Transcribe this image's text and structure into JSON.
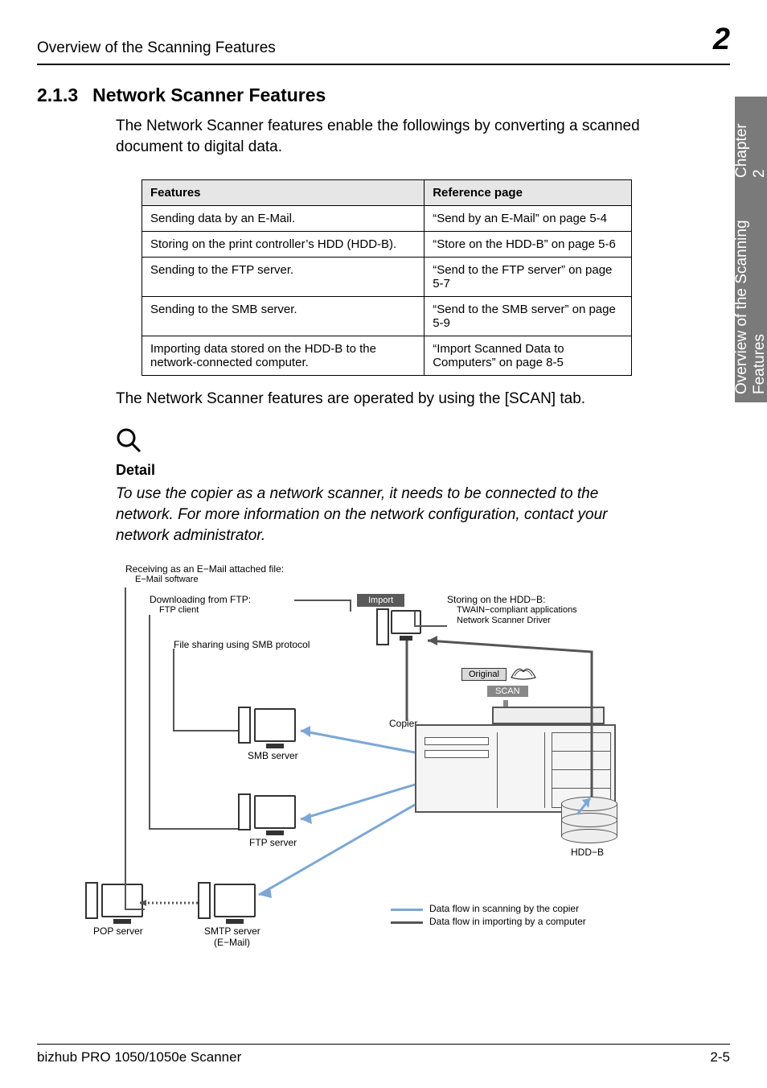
{
  "header": {
    "left": "Overview of the Scanning Features",
    "right": "2"
  },
  "side_tab": {
    "line1": "Overview of the Scanning Features",
    "line2": "Chapter 2"
  },
  "section": {
    "number": "2.1.3",
    "title": "Network Scanner Features",
    "intro": "The Network Scanner features enable the followings by converting a scanned document to digital data."
  },
  "table": {
    "headers": [
      "Features",
      "Reference page"
    ],
    "rows": [
      [
        "Sending data by an E-Mail.",
        "“Send by an E-Mail” on page 5-4"
      ],
      [
        "Storing on the print controller’s HDD (HDD-B).",
        "“Store on the HDD-B” on page 5-6"
      ],
      [
        "Sending to the FTP server.",
        "“Send to the FTP server” on page 5-7"
      ],
      [
        "Sending to the SMB server.",
        "“Send to the SMB server” on page 5-9"
      ],
      [
        "Importing data stored on the HDD-B to the network-connected computer.",
        "“Import Scanned Data to Computers” on page 8-5"
      ]
    ]
  },
  "after_table": "The Network Scanner features are operated by using the [SCAN] tab.",
  "detail": {
    "heading": "Detail",
    "body": "To use the copier as a network scanner, it needs to be connected to the network. For more information on the network configuration, contact your network administrator."
  },
  "diagram": {
    "caption_top1": "Receiving as an E−Mail attached file:",
    "caption_top2": "E−Mail software",
    "downloading_label1": "Downloading from FTP:",
    "downloading_label2": "FTP client",
    "file_sharing": "File sharing using SMB protocol",
    "import": "Import",
    "storing1": "Storing on the HDD−B:",
    "storing2": "TWAIN−compliant applications",
    "storing3": "Network Scanner Driver",
    "original": "Original",
    "scan": "SCAN",
    "copier": "Copier",
    "smb_server": "SMB server",
    "ftp_server": "FTP server",
    "hdd_b": "HDD−B",
    "pop_server": "POP server",
    "smtp_server1": "SMTP server",
    "smtp_server2": "(E−Mail)",
    "legend_copier": "Data flow in scanning by the copier",
    "legend_computer": "Data flow in importing by a computer"
  },
  "footer": {
    "left": "bizhub PRO 1050/1050e Scanner",
    "right": "2-5"
  }
}
